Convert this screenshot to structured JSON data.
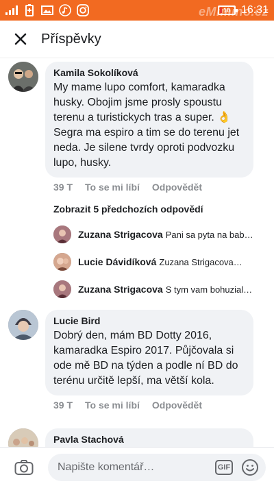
{
  "status_bar": {
    "time": "16:31",
    "battery": "10",
    "watermark": "eMimino.cz"
  },
  "header": {
    "title": "Příspěvky"
  },
  "comments": [
    {
      "author": "Kamila Sokolíková",
      "text": "My mame lupo comfort, kamaradka husky. Obojim jsme prosly spoustu terenu a turistickych tras a super. 👌 Segra ma espiro a tim se do terenu jet neda. Je silene tvrdy oproti podvozku lupo, husky.",
      "time": "39 T",
      "like": "To se mi líbí",
      "reply": "Odpovědět"
    },
    {
      "author": "Lucie Bird",
      "text": "Dobrý den, mám BD Dotty 2016, kamaradka Espiro 2017. Půjčovala si ode mě BD na týden a podle ní BD do terénu určitě lepší, ma větší kola.",
      "time": "39 T",
      "like": "To se mi líbí",
      "reply": "Odpovědět"
    },
    {
      "author": "Pavla Stachová"
    }
  ],
  "view_previous": "Zobrazit 5 předchozích odpovědí",
  "replies": [
    {
      "name": "Zuzana Strigacova",
      "text": "Pani sa pyta na bab…"
    },
    {
      "name": "Lucie Dávidíková",
      "text": "Zuzana Strigacova…"
    },
    {
      "name": "Zuzana Strigacova",
      "text": "S tym vam bohuzial…"
    }
  ],
  "composer": {
    "placeholder": "Napište komentář…",
    "gif": "GIF"
  },
  "colors": {
    "status_bar": "#f26a21",
    "bubble": "#f0f2f5",
    "meta": "#8a8d91"
  }
}
